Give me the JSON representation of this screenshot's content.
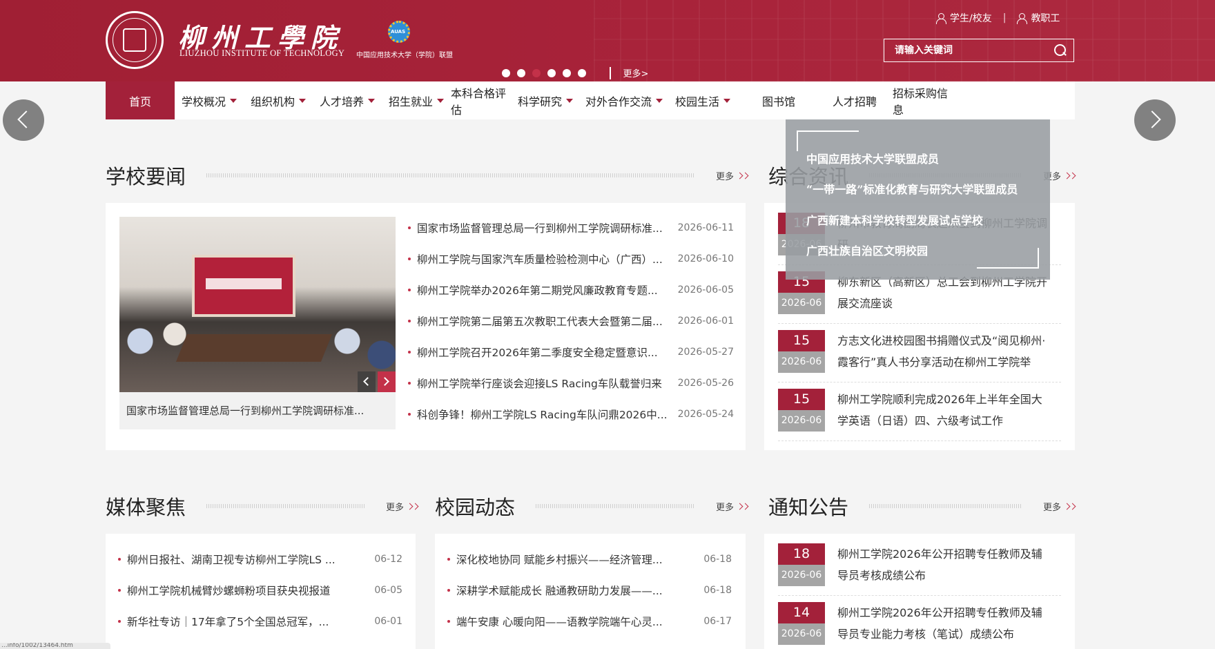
{
  "header": {
    "logo_cn": "柳州工學院",
    "logo_en": "LIUZHOU INSTITUTE OF TECHNOLOGY",
    "alliance_text": "中国应用技术大学（学院）联盟",
    "user_links": [
      "学生/校友",
      "教职工"
    ],
    "user_icons": [
      "user-icon",
      "user-icon"
    ],
    "search_placeholder": "请输入关键词",
    "banner_more": "更多>",
    "banner_slides": 6,
    "active_slide_index": 2
  },
  "nav": {
    "items": [
      {
        "label": "首页",
        "has_menu": false
      },
      {
        "label": "学校概况",
        "has_menu": true
      },
      {
        "label": "组织机构",
        "has_menu": true
      },
      {
        "label": "人才培养",
        "has_menu": true
      },
      {
        "label": "招生就业",
        "has_menu": true
      },
      {
        "label": "本科合格评估",
        "has_menu": false
      },
      {
        "label": "科学研究",
        "has_menu": true
      },
      {
        "label": "对外合作交流",
        "has_menu": true
      },
      {
        "label": "校园生活",
        "has_menu": true
      },
      {
        "label": "图书馆",
        "has_menu": false
      },
      {
        "label": "人才招聘",
        "has_menu": false
      },
      {
        "label": "招标采购信息",
        "has_menu": false
      }
    ],
    "active_index": 0
  },
  "honors": [
    "中国应用技术大学联盟成员",
    "“一带一路”标准化教育与研究大学联盟成员",
    "广西新建本科学校转型发展试点学校",
    "广西壮族自治区文明校园"
  ],
  "school_news": {
    "title": "学校要闻",
    "more": "更多",
    "photo_caption": "国家市场监督管理总局一行到柳州工学院调研标准...",
    "items": [
      {
        "title": "国家市场监督管理总局一行到柳州工学院调研标准...",
        "date": "2026-06-11"
      },
      {
        "title": "柳州工学院与国家汽车质量检验检测中心（广西）...",
        "date": "2026-06-10"
      },
      {
        "title": "柳州工学院举办2026年第二期党风廉政教育专题...",
        "date": "2026-06-05"
      },
      {
        "title": "柳州工学院第二届第五次教职工代表大会暨第二届...",
        "date": "2026-06-01"
      },
      {
        "title": "柳州工学院召开2026年第二季度安全稳定暨意识...",
        "date": "2026-05-27"
      },
      {
        "title": "柳州工学院举行座谈会迎接LS Racing车队载誉归来",
        "date": "2026-05-26"
      },
      {
        "title": "科创争锋！柳州工学院LS Racing车队问鼎2026中...",
        "date": "2026-05-24"
      }
    ]
  },
  "general_news": {
    "title": "综合资讯",
    "more": "更多",
    "items": [
      {
        "day": "18",
        "ym": "2026-06",
        "title": "柳州市教育局副局长赵从宝到柳州工学院调研"
      },
      {
        "day": "15",
        "ym": "2026-06",
        "title": "柳东新区（高新区）总工会到柳州工学院开展交流座谈"
      },
      {
        "day": "15",
        "ym": "2026-06",
        "title": "方志文化进校园图书捐赠仪式及“阅见柳州·霞客行”真人书分享活动在柳州工学院举"
      },
      {
        "day": "15",
        "ym": "2026-06",
        "title": "柳州工学院顺利完成2026年上半年全国大学英语（日语）四、六级考试工作"
      }
    ]
  },
  "media": {
    "title": "媒体聚焦",
    "more": "更多",
    "items": [
      {
        "title": "柳州日报社、湖南卫视专访柳州工学院LS ...",
        "date": "06-12"
      },
      {
        "title": "柳州工学院机械臂炒螺蛳粉项目获央视报道",
        "date": "06-05"
      },
      {
        "title": "新华社专访｜17年拿了5个全国总冠军，...",
        "date": "06-01"
      }
    ]
  },
  "campus": {
    "title": "校园动态",
    "more": "更多",
    "items": [
      {
        "title": "深化校地协同 赋能乡村振兴——经济管理...",
        "date": "06-18"
      },
      {
        "title": "深耕学术赋能成长 融通教研助力发展——...",
        "date": "06-18"
      },
      {
        "title": "端午安康 心暖向阳——语教学院端午心灵...",
        "date": "06-17"
      }
    ]
  },
  "notices": {
    "title": "通知公告",
    "more": "更多",
    "items": [
      {
        "day": "18",
        "ym": "2026-06",
        "title": "柳州工学院2026年公开招聘专任教师及辅导员考核成绩公布"
      },
      {
        "day": "14",
        "ym": "2026-06",
        "title": "柳州工学院2026年公开招聘专任教师及辅导员专业能力考核（笔试）成绩公布"
      }
    ]
  },
  "status_bar": "...info/1002/13464.htm",
  "colors": {
    "brand": "#a3213a",
    "accent": "#c33149",
    "date_box": "#a5a5a5"
  }
}
